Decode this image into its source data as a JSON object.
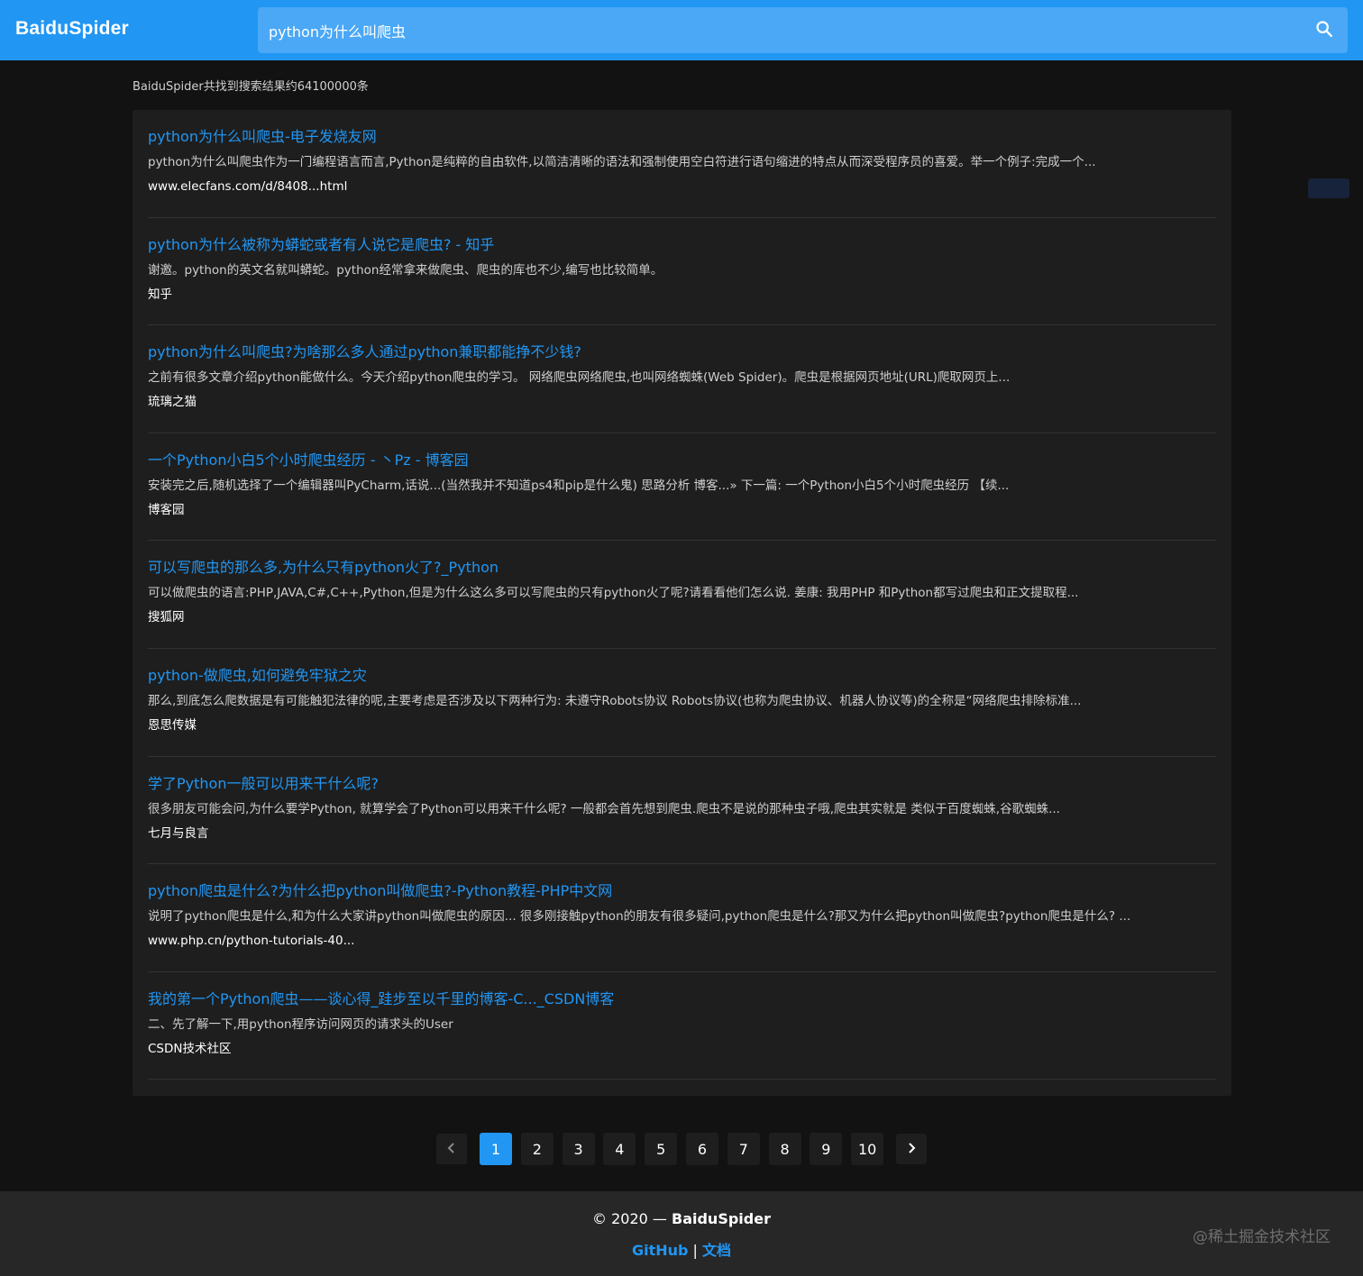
{
  "header": {
    "brand": "BaiduSpider",
    "search_value": "python为什么叫爬虫",
    "search_icon": "magnifier-icon"
  },
  "result_count": "BaiduSpider共找到搜索结果约64100000条",
  "results": [
    {
      "title": "python为什么叫爬虫-电子发烧友网",
      "desc": "python为什么叫爬虫作为一门编程语言而言,Python是纯粹的自由软件,以简洁清晰的语法和强制使用空白符进行语句缩进的特点从而深受程序员的喜爱。举一个例子:完成一个...",
      "source": "www.elecfans.com/d/8408...html"
    },
    {
      "title": "python为什么被称为蟒蛇或者有人说它是爬虫? - 知乎",
      "desc": "谢邀。python的英文名就叫蟒蛇。python经常拿来做爬虫、爬虫的库也不少,编写也比较简单。",
      "source": "知乎"
    },
    {
      "title": "python为什么叫爬虫?为啥那么多人通过python兼职都能挣不少钱?",
      "desc": "之前有很多文章介绍python能做什么。今天介绍python爬虫的学习。 网络爬虫网络爬虫,也叫网络蜘蛛(Web Spider)。爬虫是根据网页地址(URL)爬取网页上...",
      "source": "琉璃之猫"
    },
    {
      "title": "一个Python小白5个小时爬虫经历 - 丶Pz - 博客园",
      "desc": "安装完之后,随机选择了一个编辑器叫PyCharm,话说...(当然我并不知道ps4和pip是什么鬼) 思路分析 博客...» 下一篇: 一个Python小白5个小时爬虫经历 【续...",
      "source": "博客园"
    },
    {
      "title": "可以写爬虫的那么多,为什么只有python火了?_Python",
      "desc": "可以做爬虫的语言:PHP,JAVA,C#,C++,Python,但是为什么这么多可以写爬虫的只有python火了呢?请看看他们怎么说. 姜康: 我用PHP 和Python都写过爬虫和正文提取程...",
      "source": "搜狐网"
    },
    {
      "title": "python-做爬虫,如何避免牢狱之灾",
      "desc": "那么,到底怎么爬数据是有可能触犯法律的呢,主要考虑是否涉及以下两种行为: 未遵守Robots协议 Robots协议(也称为爬虫协议、机器人协议等)的全称是“网络爬虫排除标准...",
      "source": "恩思传媒"
    },
    {
      "title": "学了Python一般可以用来干什么呢?",
      "desc": "很多朋友可能会问,为什么要学Python, 就算学会了Python可以用来干什么呢? 一般都会首先想到爬虫.爬虫不是说的那种虫子哦,爬虫其实就是 类似于百度蜘蛛,谷歌蜘蛛...",
      "source": "七月与良言"
    },
    {
      "title": "python爬虫是什么?为什么把python叫做爬虫?-Python教程-PHP中文网",
      "desc": "说明了python爬虫是什么,和为什么大家讲python叫做爬虫的原因... 很多刚接触python的朋友有很多疑问,python爬虫是什么?那又为什么把python叫做爬虫?python爬虫是什么? ...",
      "source": "www.php.cn/python-tutorials-40..."
    },
    {
      "title": "我的第一个Python爬虫——谈心得_跬步至以千里的博客-C..._CSDN博客",
      "desc": "二、先了解一下,用python程序访问网页的请求头的User",
      "source": "CSDN技术社区"
    }
  ],
  "pagination": {
    "prev_icon": "chevron-left-icon",
    "next_icon": "chevron-right-icon",
    "pages": [
      "1",
      "2",
      "3",
      "4",
      "5",
      "6",
      "7",
      "8",
      "9",
      "10"
    ],
    "active": "1"
  },
  "footer": {
    "copyright_prefix": "© 2020 — ",
    "copyright_brand": "BaiduSpider",
    "github_label": "GitHub",
    "separator": " | ",
    "docs_label": "文档",
    "watermark": "@稀土掘金技术社区"
  },
  "colors": {
    "accent": "#2196f3",
    "background": "#121212",
    "card": "#1e1e1e",
    "footer": "#272727"
  }
}
